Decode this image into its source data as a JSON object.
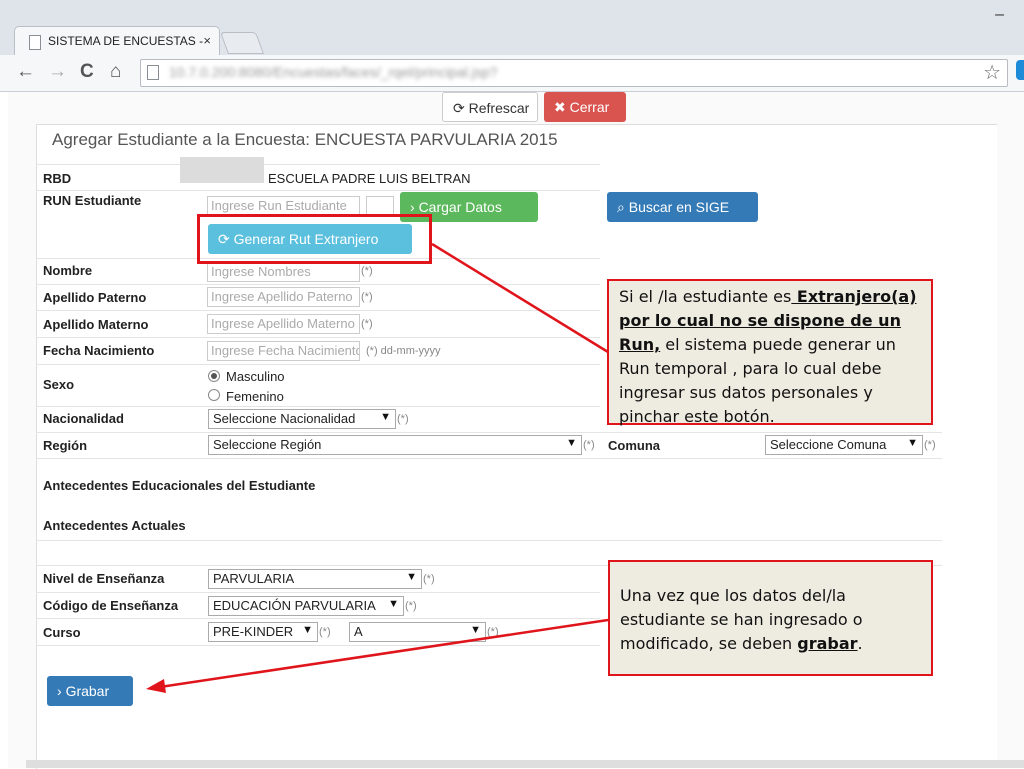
{
  "browser": {
    "tab_title": "SISTEMA DE ENCUESTAS -",
    "tab_close": "×",
    "minimize": "–",
    "url": "10.7.0.200:8080/Encuestas/faces/_rqel/principal.jsp?",
    "nav": {
      "back": "←",
      "forward": "→",
      "reload": "C",
      "home": "⌂"
    },
    "star": "☆"
  },
  "top_buttons": {
    "refresh": "Refrescar",
    "close": "Cerrar",
    "refresh_icon": "⟳",
    "close_icon": "✖"
  },
  "form": {
    "heading": "Agregar Estudiante a la Encuesta: ENCUESTA PARVULARIA 2015",
    "rbd": {
      "label": "RBD",
      "school": "ESCUELA PADRE LUIS BELTRAN"
    },
    "run": {
      "label": "RUN Estudiante",
      "placeholder": "Ingrese Run Estudiante",
      "cargar": "Cargar Datos",
      "buscar": "Buscar en SIGE",
      "generar": "Generar Rut Extranjero"
    },
    "nombre": {
      "label": "Nombre",
      "placeholder": "Ingrese Nombres"
    },
    "apellido_paterno": {
      "label": "Apellido Paterno",
      "placeholder": "Ingrese Apellido Paterno"
    },
    "apellido_materno": {
      "label": "Apellido Materno",
      "placeholder": "Ingrese Apellido Materno"
    },
    "fecha": {
      "label": "Fecha Nacimiento",
      "placeholder": "Ingrese Fecha Nacimiento",
      "hint": "(*) dd-mm-yyyy"
    },
    "sexo": {
      "label": "Sexo",
      "options": [
        "Masculino",
        "Femenino"
      ],
      "selected": "Masculino"
    },
    "nacionalidad": {
      "label": "Nacionalidad",
      "value": "Seleccione Nacionalidad"
    },
    "region": {
      "label": "Región",
      "value": "Seleccione Región"
    },
    "comuna": {
      "label": "Comuna",
      "value": "Seleccione Comuna"
    },
    "required": "(*)",
    "sec_educacionales": "Antecedentes Educacionales del Estudiante",
    "sec_actuales": "Antecedentes Actuales",
    "nivel": {
      "label": "Nivel de Enseñanza",
      "value": "PARVULARIA"
    },
    "codigo": {
      "label": "Código de Enseñanza",
      "value": "EDUCACIÓN PARVULARIA"
    },
    "curso": {
      "label": "Curso",
      "value": "PRE-KINDER",
      "letra": "A"
    },
    "grabar": "Grabar"
  },
  "callouts": {
    "foreign": {
      "pre": "Si el /la estudiante es",
      "bold": " Extranjero(a) por lo cual no se dispone de un Run,",
      "post": " el sistema puede generar un Run temporal , para lo cual debe ingresar sus  datos personales y pinchar este botón."
    },
    "save": {
      "pre": "Una vez que los datos del/la estudiante se han ingresado o modificado, se deben ",
      "bold": "grabar",
      "post": "."
    }
  },
  "colors": {
    "accent_red": "#e0141b",
    "btn_blue": "#337ab7",
    "btn_green": "#5cb85c",
    "btn_cyan": "#5bc0de",
    "btn_danger": "#d9534f",
    "callout_bg": "#eeece1"
  }
}
